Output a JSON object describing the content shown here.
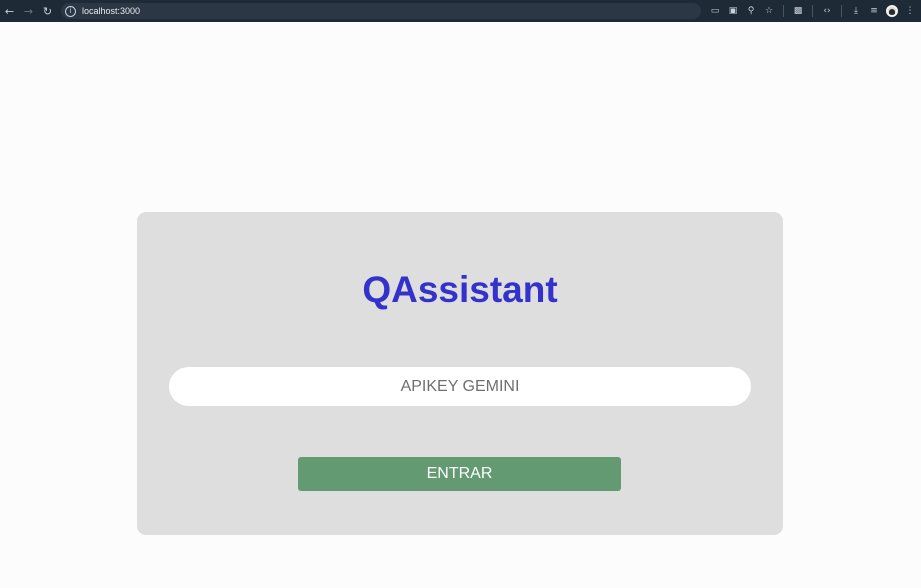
{
  "browser": {
    "url": "localhost:3000",
    "icons": {
      "back": "arrow-left-icon",
      "forward": "arrow-right-icon",
      "reload": "reload-icon",
      "site_info": "site-info-icon",
      "cast": "cast-icon",
      "translate": "translate-icon",
      "zoom": "zoom-icon",
      "bookmark": "star-icon",
      "extensions": "puzzle-icon",
      "devtools": "code-icon",
      "download": "download-icon",
      "media": "media-control-icon",
      "profile": "avatar",
      "menu": "kebab-menu-icon"
    }
  },
  "app": {
    "title": "QAssistant",
    "api_input": {
      "placeholder": "APIKEY GEMINI",
      "value": ""
    },
    "submit_label": "ENTRAR"
  },
  "colors": {
    "title": "#3333cc",
    "button": "#639a71",
    "card": "#dedede",
    "toolbar": "#1f2a37"
  }
}
